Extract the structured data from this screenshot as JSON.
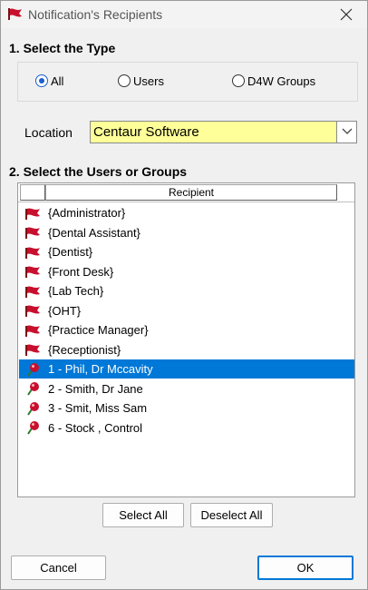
{
  "window": {
    "title": "Notification's Recipients"
  },
  "section1": {
    "label": "1. Select the Type"
  },
  "radios": [
    {
      "label": "All",
      "checked": true
    },
    {
      "label": "Users",
      "checked": false
    },
    {
      "label": "D4W Groups",
      "checked": false
    }
  ],
  "location": {
    "label": "Location",
    "value": "Centaur Software"
  },
  "section2": {
    "label": "2. Select the Users or Groups"
  },
  "list": {
    "header": "Recipient",
    "items": [
      {
        "label": "{Administrator}",
        "icon": "group-flag-icon"
      },
      {
        "label": "{Dental Assistant}",
        "icon": "group-flag-icon"
      },
      {
        "label": "{Dentist}",
        "icon": "group-flag-icon"
      },
      {
        "label": "{Front Desk}",
        "icon": "group-flag-icon"
      },
      {
        "label": "{Lab Tech}",
        "icon": "group-flag-icon"
      },
      {
        "label": "{OHT}",
        "icon": "group-flag-icon"
      },
      {
        "label": "{Practice Manager}",
        "icon": "group-flag-icon"
      },
      {
        "label": "{Receptionist}",
        "icon": "group-flag-icon"
      },
      {
        "label": "1 - Phil, Dr Mccavity",
        "icon": "user-pin-icon",
        "selected": true
      },
      {
        "label": "2 - Smith, Dr Jane",
        "icon": "user-pin-icon"
      },
      {
        "label": "3 - Smit, Miss Sam",
        "icon": "user-pin-icon"
      },
      {
        "label": "6 - Stock , Control",
        "icon": "user-pin-icon"
      }
    ]
  },
  "buttons": {
    "select_all": "Select All",
    "deselect_all": "Deselect All",
    "cancel": "Cancel",
    "ok": "OK"
  },
  "colors": {
    "selection": "#0078d7",
    "location_bg": "#ffff99",
    "flag_red": "#c8102e"
  }
}
